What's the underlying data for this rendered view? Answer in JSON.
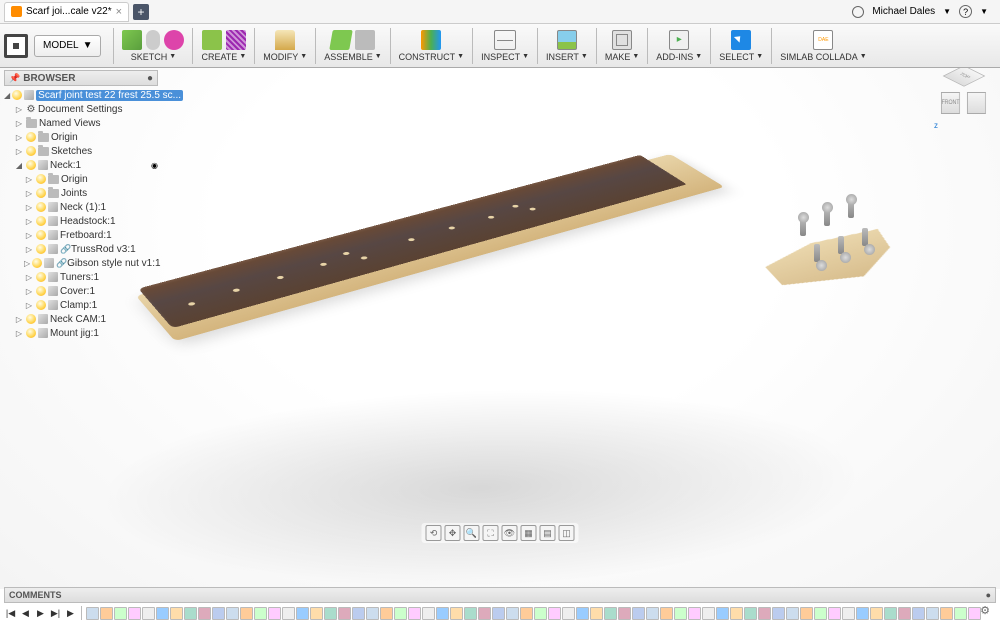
{
  "tab": {
    "title": "Scarf joi...cale v22*",
    "close": "×",
    "add": "+"
  },
  "user": {
    "name": "Michael Dales",
    "help": "?"
  },
  "toolbar": {
    "model": "MODEL",
    "groups": {
      "sketch": "SKETCH",
      "create": "CREATE",
      "modify": "MODIFY",
      "assemble": "ASSEMBLE",
      "construct": "CONSTRUCT",
      "inspect": "INSPECT",
      "insert": "INSERT",
      "make": "MAKE",
      "addins": "ADD-INS",
      "select": "SELECT",
      "collada": "SIMLAB COLLADA",
      "collada_badge": "DAE"
    }
  },
  "browser": {
    "header": "BROWSER",
    "root": "Scarf joint test 22 frest 25.5 sc...",
    "items": {
      "doc_settings": "Document Settings",
      "named_views": "Named Views",
      "origin": "Origin",
      "sketches": "Sketches",
      "neck": "Neck:1",
      "neck_origin": "Origin",
      "joints": "Joints",
      "neck1": "Neck (1):1",
      "headstock": "Headstock:1",
      "fretboard": "Fretboard:1",
      "trussrod": "TrussRod v3:1",
      "nut": "Gibson style nut v1:1",
      "tuners": "Tuners:1",
      "cover": "Cover:1",
      "clamp": "Clamp:1",
      "neck_cam": "Neck CAM:1",
      "mount_jig": "Mount jig:1"
    }
  },
  "viewcube": {
    "top": "TOP",
    "front": "FRONT"
  },
  "comments": "COMMENTS",
  "timeline": {
    "controls": {
      "start": "|◀",
      "back": "◀",
      "fwd": "▶",
      "play": "▶",
      "end": "▶|"
    }
  }
}
